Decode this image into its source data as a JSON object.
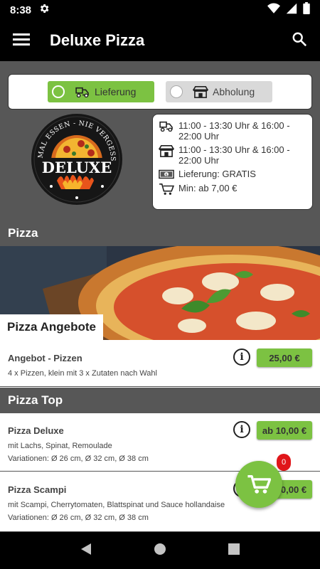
{
  "status_bar": {
    "time": "8:38"
  },
  "app_bar": {
    "title": "Deluxe Pizza"
  },
  "order_mode": {
    "delivery_label": "Lieferung",
    "pickup_label": "Abholung",
    "selected": "delivery"
  },
  "logo": {
    "arc_text": "EINMAL ESSEN - NIE VERGESSEN",
    "brand": "DELUXE"
  },
  "info": {
    "delivery_hours": "11:00 - 13:30 Uhr & 16:00 - 22:00 Uhr",
    "pickup_hours": "11:00 - 13:30 Uhr & 16:00 - 22:00 Uhr",
    "delivery_fee": "Lieferung: GRATIS",
    "minimum": "Min: ab 7,00 €"
  },
  "sections": {
    "pizza": "Pizza",
    "angebote": "Pizza Angebote",
    "top": "Pizza Top"
  },
  "products": [
    {
      "name": "Angebot - Pizzen",
      "desc": "4 x Pizzen, klein mit 3 x Zutaten nach Wahl",
      "price": "25,00 €"
    },
    {
      "name": "Pizza Deluxe",
      "desc": "mit Lachs, Spinat, Remoulade",
      "variations": "Variationen: Ø 26 cm, Ø 32 cm, Ø 38 cm",
      "price": "ab 10,00 €"
    },
    {
      "name": "Pizza Scampi",
      "desc": "mit Scampi, Cherrytomaten, Blattspinat und Sauce hollandaise",
      "variations": "Variationen: Ø 26 cm, Ø 32 cm, Ø 38 cm",
      "price": "ab 10,00 €"
    }
  ],
  "cart": {
    "count": "0"
  },
  "colors": {
    "accent": "#7cc242",
    "header": "#575757",
    "badge": "#e0161a"
  }
}
